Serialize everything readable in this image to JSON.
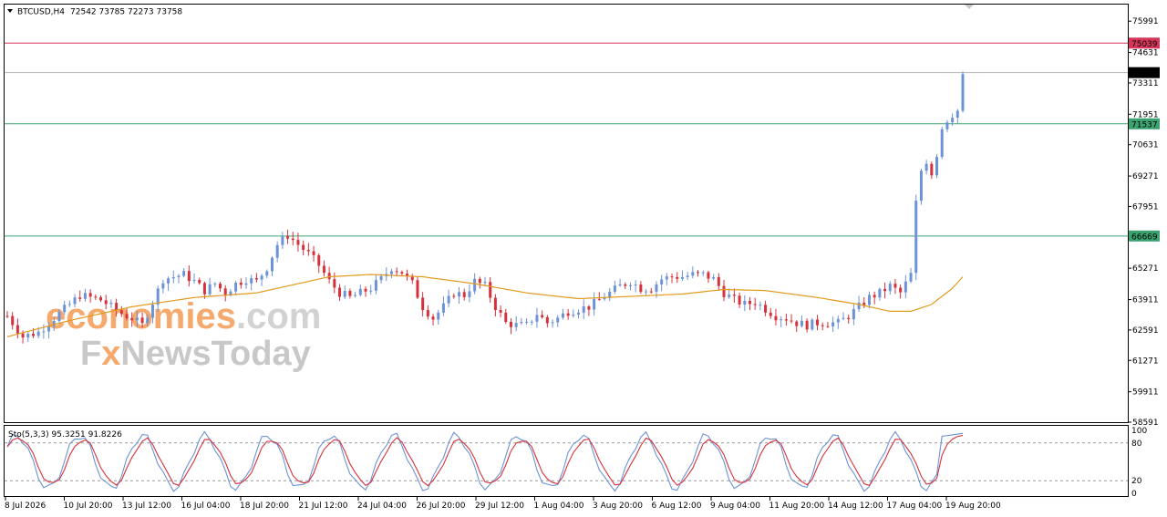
{
  "header": {
    "symbol": "BTCUSD,H4",
    "ohlc": "72542 73785 72273 73758"
  },
  "watermark": {
    "line1_a": "economies",
    "line1_b": ".com",
    "line2_a": "F",
    "line2_b": "x",
    "line2_c": "NewsToday"
  },
  "colors": {
    "bull": "#6d93d6",
    "bear": "#d6323c",
    "ma": "#e29a1c",
    "resistance": "#d6365a",
    "support": "#3aa370",
    "stoch_main": "#6d93d6",
    "stoch_signal": "#d6323c",
    "watermark_orange": "#f6a96c",
    "watermark_gray": "#c8c8c8"
  },
  "chart_data": {
    "type": "candlestick",
    "title": "BTCUSD,H4",
    "ylim": [
      58591,
      76711
    ],
    "y_ticks": [
      75991,
      74631,
      73311,
      71951,
      70631,
      69271,
      67951,
      66631,
      65271,
      63911,
      62591,
      61271,
      59911,
      58591
    ],
    "x_ticks": [
      "8 Jul 2026",
      "10 Jul 20:00",
      "13 Jul 12:00",
      "16 Jul 04:00",
      "18 Jul 20:00",
      "21 Jul 12:00",
      "24 Jul 04:00",
      "26 Jul 20:00",
      "29 Jul 12:00",
      "1 Aug 04:00",
      "3 Aug 20:00",
      "6 Aug 12:00",
      "9 Aug 04:00",
      "11 Aug 20:00",
      "14 Aug 12:00",
      "17 Aug 04:00",
      "19 Aug 20:00"
    ],
    "levels": [
      {
        "label": "75039",
        "value": 75039,
        "kind": "resistance"
      },
      {
        "label": "73758",
        "value": 73758,
        "kind": "current"
      },
      {
        "label": "71537",
        "value": 71537,
        "kind": "support"
      },
      {
        "label": "66669",
        "value": 66669,
        "kind": "support"
      }
    ],
    "price_anchors": [
      [
        0,
        63200
      ],
      [
        3,
        62300
      ],
      [
        6,
        62500
      ],
      [
        10,
        63300
      ],
      [
        14,
        64100
      ],
      [
        18,
        63900
      ],
      [
        20,
        63600
      ],
      [
        22,
        63300
      ],
      [
        24,
        63100
      ],
      [
        26,
        62800
      ],
      [
        28,
        63800
      ],
      [
        30,
        64800
      ],
      [
        34,
        65000
      ],
      [
        36,
        64700
      ],
      [
        38,
        64300
      ],
      [
        40,
        64600
      ],
      [
        42,
        64200
      ],
      [
        44,
        64600
      ],
      [
        46,
        64800
      ],
      [
        48,
        64700
      ],
      [
        50,
        65300
      ],
      [
        52,
        66300
      ],
      [
        54,
        66700
      ],
      [
        56,
        66300
      ],
      [
        58,
        65900
      ],
      [
        60,
        65400
      ],
      [
        62,
        64700
      ],
      [
        64,
        64200
      ],
      [
        66,
        64000
      ],
      [
        68,
        64200
      ],
      [
        70,
        64400
      ],
      [
        72,
        64800
      ],
      [
        74,
        65300
      ],
      [
        76,
        65100
      ],
      [
        78,
        64600
      ],
      [
        80,
        63600
      ],
      [
        82,
        63100
      ],
      [
        84,
        63600
      ],
      [
        86,
        64200
      ],
      [
        88,
        64100
      ],
      [
        90,
        64700
      ],
      [
        92,
        64500
      ],
      [
        94,
        63600
      ],
      [
        96,
        62900
      ],
      [
        98,
        62800
      ],
      [
        100,
        62800
      ],
      [
        102,
        63300
      ],
      [
        104,
        62900
      ],
      [
        106,
        63100
      ],
      [
        108,
        63400
      ],
      [
        110,
        63500
      ],
      [
        112,
        63600
      ],
      [
        114,
        63900
      ],
      [
        116,
        64200
      ],
      [
        118,
        64500
      ],
      [
        120,
        64700
      ],
      [
        122,
        64400
      ],
      [
        124,
        64400
      ],
      [
        126,
        64800
      ],
      [
        128,
        64900
      ],
      [
        130,
        64900
      ],
      [
        132,
        65000
      ],
      [
        134,
        65000
      ],
      [
        136,
        64800
      ],
      [
        138,
        64200
      ],
      [
        140,
        63900
      ],
      [
        142,
        63700
      ],
      [
        144,
        63800
      ],
      [
        146,
        63500
      ],
      [
        148,
        63200
      ],
      [
        150,
        63100
      ],
      [
        152,
        62900
      ],
      [
        154,
        62800
      ],
      [
        156,
        62900
      ],
      [
        158,
        62900
      ],
      [
        160,
        62900
      ],
      [
        162,
        63200
      ],
      [
        164,
        63600
      ],
      [
        166,
        64000
      ],
      [
        168,
        64200
      ],
      [
        170,
        64500
      ],
      [
        172,
        64200
      ],
      [
        174,
        65000
      ],
      [
        175,
        68200
      ],
      [
        176,
        69500
      ],
      [
        177,
        69800
      ],
      [
        178,
        69300
      ],
      [
        179,
        70100
      ],
      [
        180,
        71300
      ],
      [
        181,
        71600
      ],
      [
        182,
        71800
      ],
      [
        183,
        72100
      ],
      [
        184,
        73700
      ]
    ],
    "ma_anchors": [
      [
        0,
        62300
      ],
      [
        12,
        63000
      ],
      [
        24,
        63600
      ],
      [
        36,
        64000
      ],
      [
        48,
        64200
      ],
      [
        56,
        64600
      ],
      [
        62,
        64900
      ],
      [
        70,
        65000
      ],
      [
        80,
        64900
      ],
      [
        90,
        64600
      ],
      [
        100,
        64200
      ],
      [
        110,
        63950
      ],
      [
        120,
        64050
      ],
      [
        130,
        64150
      ],
      [
        138,
        64350
      ],
      [
        146,
        64300
      ],
      [
        156,
        64000
      ],
      [
        164,
        63700
      ],
      [
        170,
        63400
      ],
      [
        174,
        63400
      ],
      [
        178,
        63700
      ],
      [
        182,
        64400
      ],
      [
        184,
        64900
      ]
    ],
    "stochastic": {
      "label": "Sto(5,3,3) 95.3251 91.8226",
      "main": 95.3251,
      "signal": 91.8226,
      "ylim": [
        0,
        100
      ],
      "y_ticks": [
        100,
        80,
        20,
        0
      ],
      "levels": [
        20,
        80
      ]
    }
  }
}
